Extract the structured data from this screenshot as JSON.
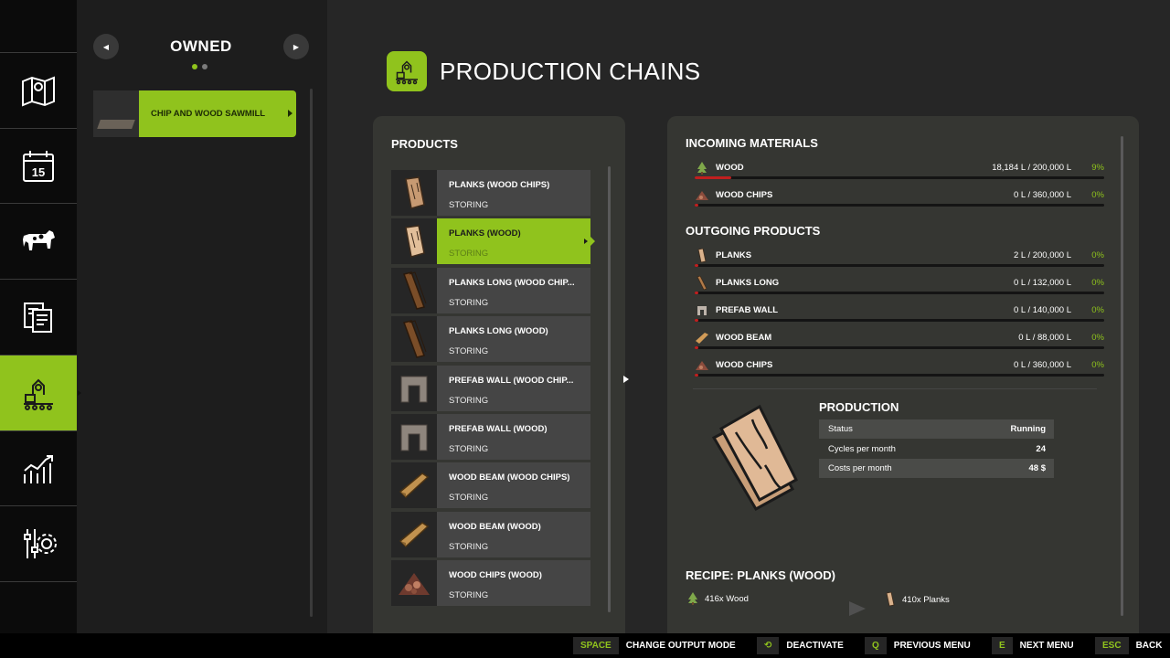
{
  "rail": {
    "items": [
      {
        "icon": "map-icon"
      },
      {
        "icon": "calendar-icon",
        "label": "15"
      },
      {
        "icon": "cow-icon"
      },
      {
        "icon": "contracts-icon"
      },
      {
        "icon": "production-icon"
      },
      {
        "icon": "statistics-icon"
      },
      {
        "icon": "settings-icon"
      }
    ],
    "active_index": 4
  },
  "left_panel": {
    "title": "OWNED",
    "prev_glyph": "◀",
    "next_glyph": "▶",
    "page_dots": 2,
    "current_page": 1,
    "item": {
      "label": "CHIP AND WOOD SAWMILL"
    }
  },
  "header": {
    "title": "PRODUCTION CHAINS"
  },
  "products": {
    "title": "PRODUCTS",
    "items": [
      {
        "name": "PLANKS (WOOD CHIPS)",
        "status": "STORING",
        "icon": "planks-icon"
      },
      {
        "name": "PLANKS (WOOD)",
        "status": "STORING",
        "icon": "planks-icon",
        "selected": true
      },
      {
        "name": "PLANKS LONG (WOOD CHIP...",
        "status": "STORING",
        "icon": "planks-long-icon"
      },
      {
        "name": "PLANKS LONG (WOOD)",
        "status": "STORING",
        "icon": "planks-long-icon"
      },
      {
        "name": "PREFAB WALL (WOOD CHIP...",
        "status": "STORING",
        "icon": "prefab-wall-icon"
      },
      {
        "name": "PREFAB WALL (WOOD)",
        "status": "STORING",
        "icon": "prefab-wall-icon"
      },
      {
        "name": "WOOD BEAM (WOOD CHIPS)",
        "status": "STORING",
        "icon": "wood-beam-icon"
      },
      {
        "name": "WOOD BEAM (WOOD)",
        "status": "STORING",
        "icon": "wood-beam-icon"
      },
      {
        "name": "WOOD CHIPS (WOOD)",
        "status": "STORING",
        "icon": "wood-chips-icon"
      }
    ]
  },
  "incoming": {
    "title": "INCOMING MATERIALS",
    "items": [
      {
        "name": "WOOD",
        "amount": "18,184 L / 200,000 L",
        "percent": "9%",
        "fill": 0.09,
        "icon": "tree-icon"
      },
      {
        "name": "WOOD CHIPS",
        "amount": "0 L / 360,000 L",
        "percent": "0%",
        "fill": 0,
        "icon": "wood-chips-icon"
      }
    ]
  },
  "outgoing": {
    "title": "OUTGOING PRODUCTS",
    "items": [
      {
        "name": "PLANKS",
        "amount": "2 L / 200,000 L",
        "percent": "0%",
        "fill": 0,
        "icon": "planks-icon"
      },
      {
        "name": "PLANKS LONG",
        "amount": "0 L / 132,000 L",
        "percent": "0%",
        "fill": 0,
        "icon": "planks-long-icon"
      },
      {
        "name": "PREFAB WALL",
        "amount": "0 L / 140,000 L",
        "percent": "0%",
        "fill": 0,
        "icon": "prefab-wall-icon"
      },
      {
        "name": "WOOD BEAM",
        "amount": "0 L / 88,000 L",
        "percent": "0%",
        "fill": 0,
        "icon": "wood-beam-icon"
      },
      {
        "name": "WOOD CHIPS",
        "amount": "0 L / 360,000 L",
        "percent": "0%",
        "fill": 0,
        "icon": "wood-chips-icon"
      }
    ]
  },
  "production": {
    "title": "PRODUCTION",
    "rows": [
      {
        "label": "Status",
        "value": "Running"
      },
      {
        "label": "Cycles per month",
        "value": "24"
      },
      {
        "label": "Costs per month",
        "value": "48 $"
      }
    ]
  },
  "recipe": {
    "title": "RECIPE: PLANKS (WOOD)",
    "input": {
      "text": "416x Wood",
      "icon": "tree-icon"
    },
    "output": {
      "text": "410x Planks",
      "icon": "planks-icon"
    }
  },
  "bottom_bar": {
    "hints": [
      {
        "key": "SPACE",
        "label": "CHANGE OUTPUT MODE"
      },
      {
        "key": "⟲",
        "label": "DEACTIVATE"
      },
      {
        "key": "Q",
        "label": "PREVIOUS MENU"
      },
      {
        "key": "E",
        "label": "NEXT MENU"
      },
      {
        "key": "ESC",
        "label": "BACK"
      }
    ]
  },
  "colors": {
    "accent": "#90c31d",
    "bar_fill": "#c01f1f",
    "panel": "#353632"
  }
}
